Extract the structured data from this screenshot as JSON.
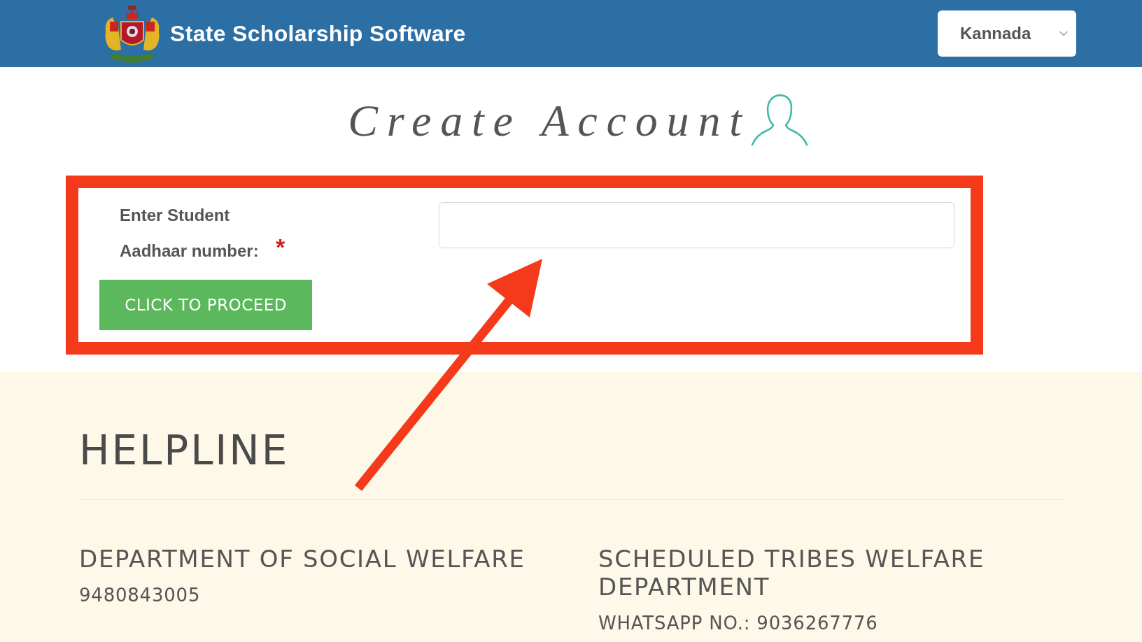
{
  "header": {
    "title": "State Scholarship Software",
    "language_select": {
      "value": "Kannada"
    }
  },
  "page_title": "Create Account",
  "form": {
    "label": "Enter Student Aadhaar number:",
    "required_mark": "*",
    "button": "CLICK TO PROCEED"
  },
  "helpline": {
    "title": "HELPLINE",
    "contacts": [
      {
        "department": "DEPARTMENT OF SOCIAL WELFARE",
        "phone": "9480843005"
      },
      {
        "department": "SCHEDULED TRIBES WELFARE DEPARTMENT",
        "phone": "WHATSAPP NO.: 9036267776"
      }
    ]
  }
}
